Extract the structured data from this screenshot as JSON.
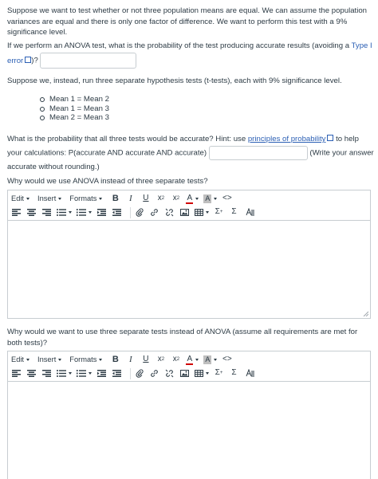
{
  "intro": "Suppose we want to test whether or not three population means are equal. We can assume the population variances are equal and there is only one factor of difference. We want to perform this test with a 9% significance level.",
  "q1": {
    "before": "If we perform an ANOVA test, what is the probability of the test producing accurate results (avoiding a ",
    "link": "Type I error",
    "after": ")?"
  },
  "q2": "Suppose we, instead, run three separate hypothesis tests (t-tests), each with 9% significance level.",
  "means": [
    "Mean 1 = Mean 2",
    "Mean 1 = Mean 3",
    "Mean 2 = Mean 3"
  ],
  "q3": {
    "before": "What is the probability that all three tests would be accurate? Hint: use ",
    "link": "principles of probability",
    "middle": " to help your calculations: P(accurate AND accurate AND accurate) ",
    "after": " (Write your answer accurate without rounding.)"
  },
  "q4": "Why would we use ANOVA instead of three separate tests?",
  "q5": "Why would we want to use three separate tests instead of ANOVA (assume all requirements are met for both tests)?",
  "toolbar": {
    "edit": "Edit",
    "insert": "Insert",
    "formats": "Formats",
    "bold": "B",
    "italic": "I",
    "underline": "U",
    "subscript_base": "x",
    "subscript_mark": "2",
    "superscript_base": "x",
    "superscript_mark": "2",
    "font_color": "A",
    "highlight": "A",
    "html_view": "<>",
    "sum": "Σ",
    "sigma": "Σ"
  }
}
